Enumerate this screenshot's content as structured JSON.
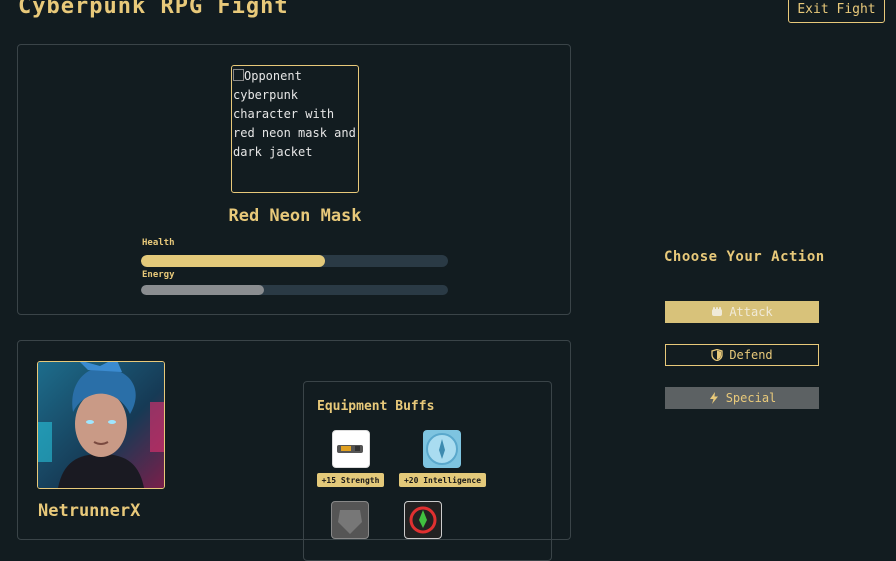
{
  "header": {
    "title": "Cyberpunk RPG Fight",
    "exit_label": "Exit Fight"
  },
  "opponent": {
    "name": "Red Neon Mask",
    "image_alt": "Opponent cyberpunk character with red neon mask and dark jacket",
    "health_label": "Health",
    "health": 0.6,
    "energy_label": "Energy",
    "energy": 0.4
  },
  "player": {
    "name": "NetrunnerX",
    "equipment_title": "Equipment Buffs",
    "equipment": [
      {
        "label": "+15 Strength",
        "icon": "cyber-arm-icon"
      },
      {
        "label": "+20 Intelligence",
        "icon": "neural-chip-icon"
      }
    ]
  },
  "actions": {
    "title": "Choose Your Action",
    "attack_label": "Attack",
    "defend_label": "Defend",
    "special_label": "Special"
  },
  "colors": {
    "accent": "#e8c97a",
    "background": "#121c20",
    "bar_track": "#2a3a45"
  }
}
